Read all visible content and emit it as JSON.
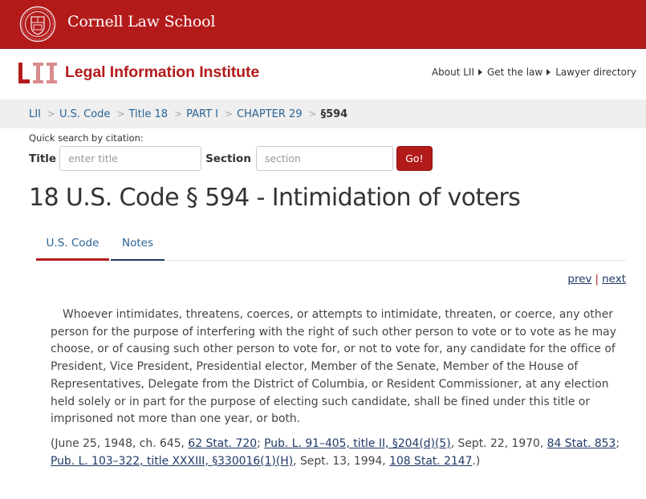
{
  "cornell_bar": {
    "name": "Cornell Law School",
    "seal_icon": "cornell-seal-icon",
    "color": "#b31b1b"
  },
  "lii_header": {
    "logo_mark": "LII",
    "logo_text": "Legal Information Institute",
    "nav": [
      {
        "label": "About LII",
        "icon": "caret-right-icon"
      },
      {
        "label": "Get the law",
        "icon": "caret-right-icon"
      },
      {
        "label": "Lawyer directory"
      }
    ]
  },
  "breadcrumb": {
    "items": [
      "LII",
      "U.S. Code",
      "Title 18",
      "PART I",
      "CHAPTER 29"
    ],
    "separator": ">",
    "current": "§594"
  },
  "quick_search": {
    "label": "Quick search by citation:",
    "title_label": "Title",
    "title_placeholder": "enter title",
    "title_value": "",
    "section_label": "Section",
    "section_placeholder": "section",
    "section_value": "",
    "go_label": "Go!"
  },
  "page_title": "18 U.S. Code § 594 - Intimidation of voters",
  "tabs": [
    {
      "label": "U.S. Code",
      "active": true
    },
    {
      "label": "Notes",
      "active": false
    }
  ],
  "pager": {
    "prev": "prev",
    "separator": "|",
    "next": "next"
  },
  "statute_text": "Whoever intimidates, threatens, coerces, or attempts to intimidate, threaten, or coerce, any other person for the purpose of interfering with the right of such other person to vote or to vote as he may choose, or of causing such other person to vote for, or not to vote for, any candidate for the office of President, Vice President, Presidential elector, Member of the Senate, Member of the House of Representatives, Delegate from the District of Columbia, or Resident Commissioner, at any election held solely or in part for the purpose of electing such candidate, shall be fined under this title or imprisoned not more than one year, or both.",
  "source_credit": {
    "t0": "(June 25, 1948, ch. 645, ",
    "l0": "62 Stat. 720",
    "t1": "; ",
    "l1": "Pub. L. 91–405, title II, §204(d)(5)",
    "t2": ", Sept. 22, 1970, ",
    "l2": "84 Stat. 853",
    "t3": "; ",
    "l3": "Pub. L. 103–322, title XXXIII, §330016(1)(H)",
    "t4": ", Sept. 13, 1994, ",
    "l4": "108 Stat. 2147",
    "t5": ".)"
  }
}
